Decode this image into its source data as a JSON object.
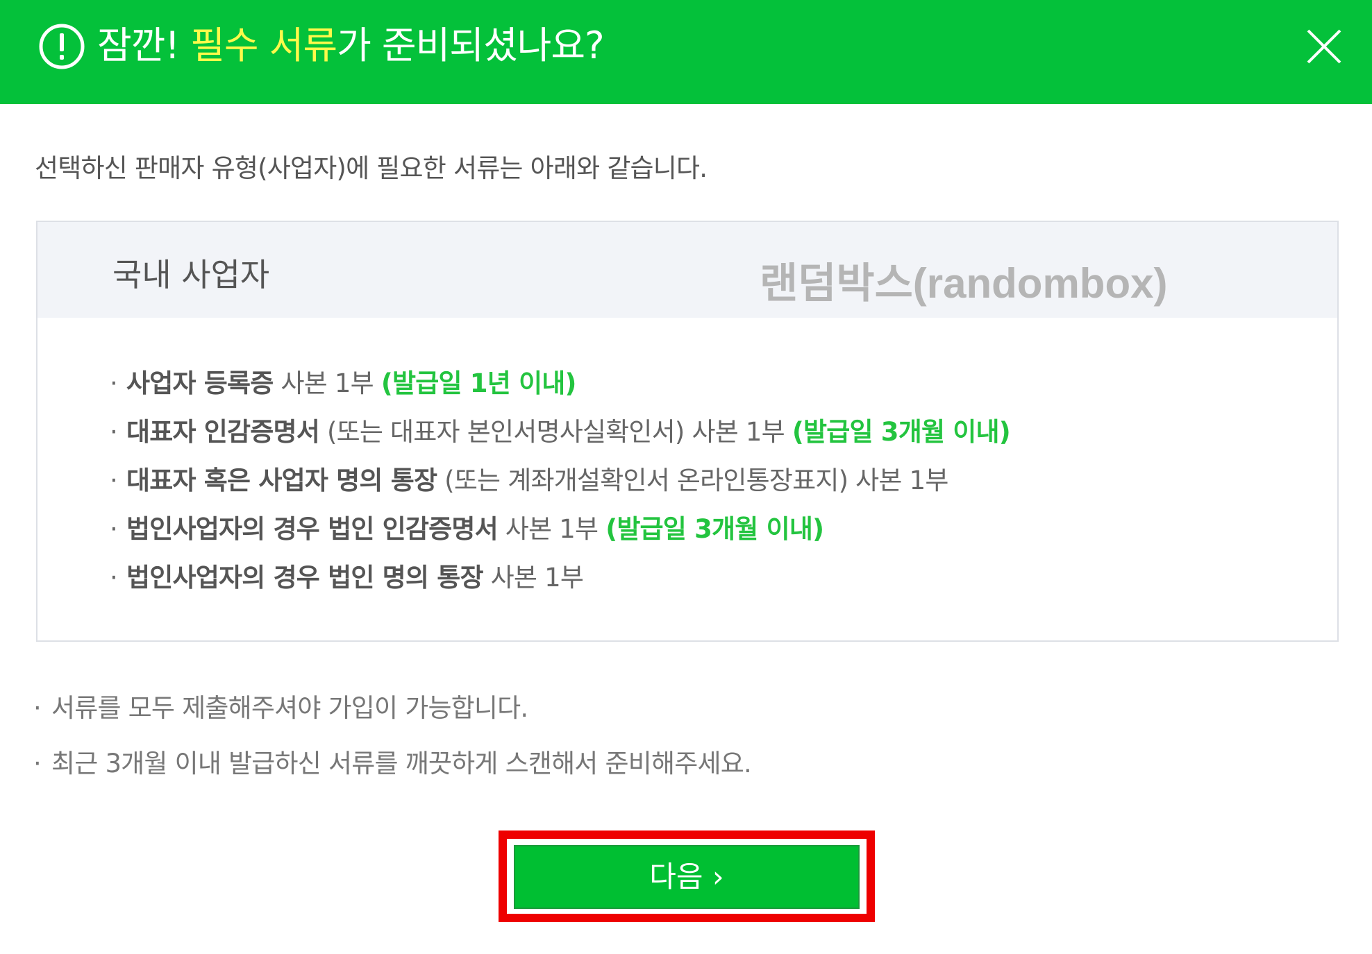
{
  "header": {
    "title_pre": "잠깐! ",
    "title_highlight": "필수 서류",
    "title_post": "가 준비되셨나요?",
    "alert_icon": "exclamation-circle-icon",
    "close_icon": "close-icon",
    "bg_color": "#04c13a",
    "highlight_color": "#fffa4a"
  },
  "intro": "선택하신 판매자 유형(사업자)에 필요한 서류는 아래와 같습니다.",
  "doc_box": {
    "title": "국내 사업자",
    "watermark": "랜덤박스(randombox)",
    "items": [
      {
        "strong": "사업자 등록증",
        "normal": " 사본 1부 ",
        "note": "(발급일 1년 이내)"
      },
      {
        "strong": "대표자 인감증명서",
        "normal": " (또는 대표자 본인서명사실확인서) 사본 1부 ",
        "note": "(발급일 3개월 이내)"
      },
      {
        "strong": "대표자 혹은 사업자 명의 통장",
        "normal": " (또는 계좌개설확인서 온라인통장표지) 사본 1부",
        "note": ""
      },
      {
        "strong": "법인사업자의 경우 법인 인감증명서",
        "normal": " 사본 1부 ",
        "note": "(발급일 3개월 이내)"
      },
      {
        "strong": "법인사업자의 경우 법인 명의 통장",
        "normal": " 사본 1부",
        "note": ""
      }
    ]
  },
  "notes": [
    "서류를 모두 제출해주셔야 가입이 가능합니다.",
    "최근 3개월 이내 발급하신 서류를 깨끗하게 스캔해서 준비해주세요."
  ],
  "bullet": "·",
  "next_button": {
    "label": "다음 ›",
    "color": "#00bf32",
    "highlight_color": "#ee0000"
  }
}
